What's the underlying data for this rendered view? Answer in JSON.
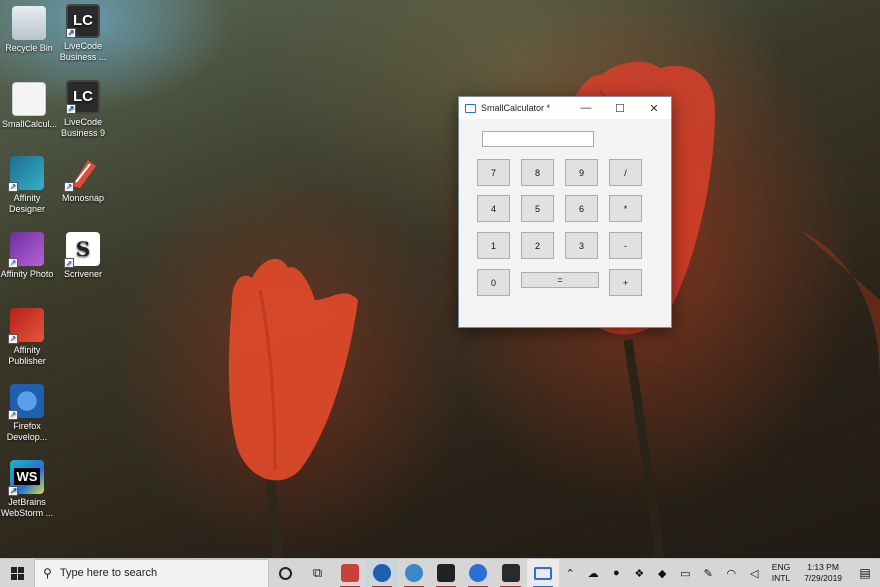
{
  "desktop": {
    "icons": [
      {
        "label": "Recycle Bin"
      },
      {
        "label": "LiveCode Business ..."
      },
      {
        "label": "SmallCalcul..."
      },
      {
        "label": "LiveCode Business 9"
      },
      {
        "label": "Affinity Designer"
      },
      {
        "label": "Monosnap"
      },
      {
        "label": "Affinity Photo"
      },
      {
        "label": "Scrivener"
      },
      {
        "label": "Affinity Publisher"
      },
      {
        "label": "Firefox Develop..."
      },
      {
        "label": "JetBrains WebStorm ..."
      }
    ],
    "lc_glyph": "LC",
    "scrivener_glyph": "S",
    "webstorm_glyph": "WS"
  },
  "window": {
    "title": "SmallCalculator *",
    "display_value": "",
    "controls": {
      "minimize": "—",
      "maximize": "☐",
      "close": "✕"
    },
    "buttons": [
      "7",
      "8",
      "9",
      "/",
      "4",
      "5",
      "6",
      "*",
      "1",
      "2",
      "3",
      "-",
      "0",
      "=",
      "+"
    ]
  },
  "taskbar": {
    "search_placeholder": "Type here to search",
    "language": {
      "line1": "ENG",
      "line2": "INTL"
    },
    "clock": {
      "time": "1:13 PM",
      "date": "7/29/2019"
    }
  },
  "colors": {
    "accent": "#2a6fd6",
    "running_indicator": "#b03030"
  }
}
